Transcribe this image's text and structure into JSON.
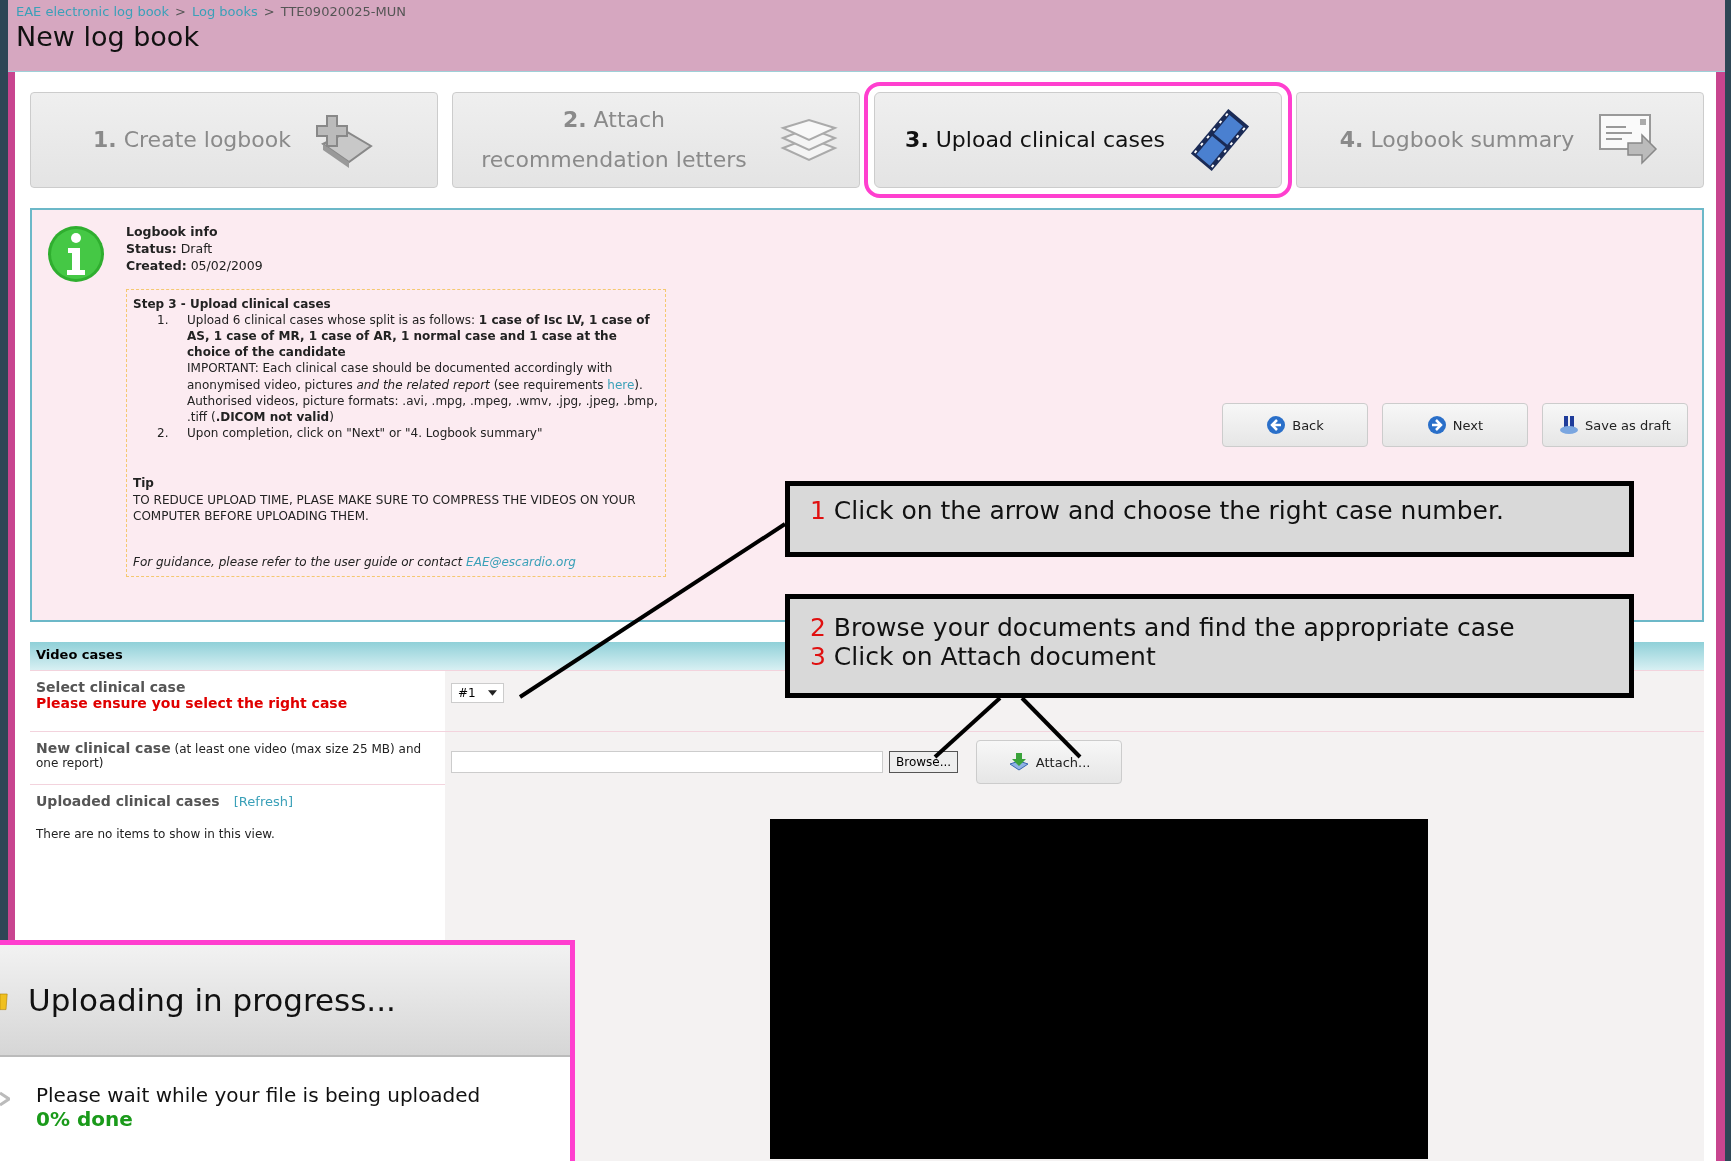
{
  "breadcrumb": [
    {
      "text": "EAE electronic log book",
      "link": true
    },
    {
      "text": "Log books",
      "link": true
    },
    {
      "text": "TTE09020025-MUN",
      "link": false
    }
  ],
  "breadcrumb_separators": [
    ">",
    ">"
  ],
  "page_title": "New log book",
  "tabs": [
    {
      "number": "1.",
      "label": "Create logbook",
      "selected": false
    },
    {
      "number": "2.",
      "label": "Attach recommendation letters",
      "selected": false
    },
    {
      "number": "3.",
      "label": "Upload clinical cases",
      "selected": true
    },
    {
      "number": "4.",
      "label": "Logbook summary",
      "selected": false
    }
  ],
  "info": {
    "heading": "Logbook info",
    "status_label": "Status:",
    "status": "Draft",
    "created_label": "Created:",
    "created": "05/02/2009",
    "step_title": "Step 3 - Upload clinical cases",
    "steps": [
      {
        "number": "1.",
        "text": "Upload 6 clinical cases whose split is as follows: **1 case of Isc LV, 1 case of AS, 1 case of MR, 1 case of AR, 1 normal case and 1 case at the choice of the candidate**",
        "important_before": "IMPORTANT: Each clinical case should be documented accordingly with anonymised video, pictures *and the related report* (see requirements",
        "link": "here",
        "important_after": "). Authorised videos, picture formats: .avi, .mpg, .mpeg, .wmv, .jpg, .jpeg, .bmp, .tiff (**.DICOM not valid**)"
      },
      {
        "number": "2.",
        "text": "Upon completion, click on \"Next\" or \"4. Logbook summary\""
      }
    ],
    "tip_title": "Tip",
    "tip": "TO REDUCE UPLOAD TIME, PLASE MAKE SURE TO COMPRESS THE VIDEOS ON YOUR COMPUTER BEFORE UPLOADING THEM.",
    "guidance": "For guidance, please refer to the user guide or contact",
    "guidance_link": "EAE@escardio.org"
  },
  "buttons": [
    "Back",
    "Next",
    "Save as draft"
  ],
  "video_cases": {
    "title": "Video cases",
    "select_label": "Select clinical case",
    "select_warning": "Please ensure you select the right case",
    "select_value": "#1",
    "new_label": "New clinical case",
    "new_hint": "(at least one video (max size 25 MB) and one report)",
    "browse": "Browse...",
    "attach": "Attach...",
    "uploaded_label": "Uploaded clinical cases",
    "refresh": "[Refresh]",
    "empty": "There are no items to show in this view."
  },
  "callouts": [
    {
      "lines": [
        {
          "number": "1",
          "text": "Click on the arrow and choose the right case number."
        }
      ]
    },
    {
      "lines": [
        {
          "number": "2",
          "text": "Browse your documents and find the appropriate case"
        },
        {
          "number": "3",
          "text": "Click on Attach document"
        }
      ]
    }
  ],
  "upload_dialog": {
    "title": "Uploading in progress...",
    "message": "Please wait while your file is being uploaded",
    "progress": "0% done"
  }
}
